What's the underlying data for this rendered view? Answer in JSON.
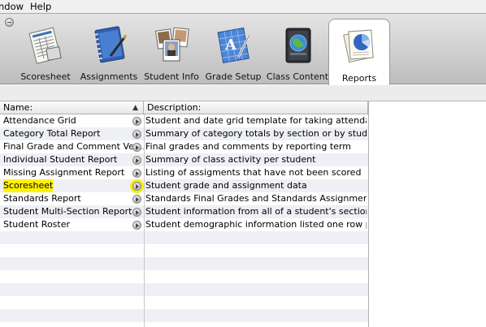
{
  "menu": {
    "items": [
      "ndow",
      "Help"
    ]
  },
  "toolbar": {
    "tabs": [
      {
        "label": "Scoresheet",
        "icon": "scoresheet-icon"
      },
      {
        "label": "Assignments",
        "icon": "assignments-icon"
      },
      {
        "label": "Student Info",
        "icon": "student-info-icon"
      },
      {
        "label": "Grade Setup",
        "icon": "grade-setup-icon"
      },
      {
        "label": "Class Content",
        "icon": "class-content-icon"
      },
      {
        "label": "Reports",
        "icon": "reports-icon",
        "active": true
      }
    ]
  },
  "table": {
    "columns": {
      "name": "Name:",
      "description": "Description:"
    },
    "sort_indicator": "▲",
    "rows": [
      {
        "name": "Attendance Grid",
        "description": "Student and date grid template for taking attendance"
      },
      {
        "name": "Category Total Report",
        "description": "Summary of category totals by section or by student"
      },
      {
        "name": "Final Grade and Comment Ver...",
        "description": "Final grades and comments by reporting term"
      },
      {
        "name": "Individual Student Report",
        "description": "Summary of class activity per student"
      },
      {
        "name": "Missing Assignment Report",
        "description": "Listing of assigments that have not been scored"
      },
      {
        "name": "Scoresheet",
        "description": "Student grade and assignment data",
        "highlighted": true
      },
      {
        "name": "Standards Report",
        "description": "Standards Final Grades and Standards Assignment S..."
      },
      {
        "name": "Student Multi-Section Report",
        "description": "Student information from all of a student's sections."
      },
      {
        "name": "Student Roster",
        "description": "Student demographic information listed one row per ..."
      }
    ]
  },
  "colors": {
    "highlight": "#fff200",
    "stripe": "#eef0f5",
    "toolbar_top": "#e4e4e4",
    "toolbar_bottom": "#bdbdbd"
  }
}
